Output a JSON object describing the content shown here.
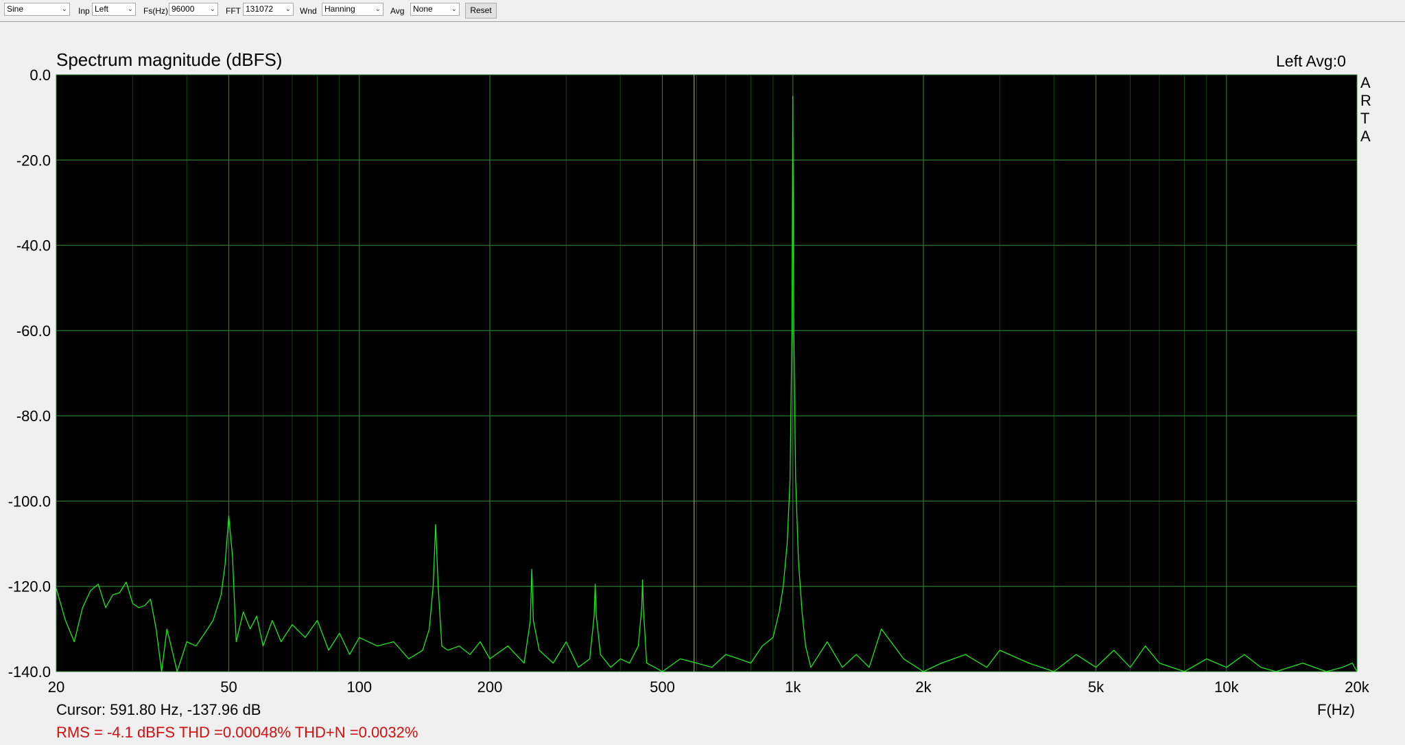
{
  "toolbar": {
    "generator": "Sine",
    "inp_label": "Inp",
    "inp_value": "Left",
    "fs_label": "Fs(Hz)",
    "fs_value": "96000",
    "fft_label": "FFT",
    "fft_value": "131072",
    "wnd_label": "Wnd",
    "wnd_value": "Hanning",
    "avg_label": "Avg",
    "avg_value": "None",
    "reset_label": "Reset",
    "chevron": "⌄"
  },
  "header": {
    "title": "Spectrum magnitude (dBFS)",
    "channel_info": "Left  Avg:0",
    "brand_letters": [
      "A",
      "R",
      "T",
      "A"
    ]
  },
  "footer": {
    "cursor_readout": "Cursor: 591.80 Hz, -137.96 dB",
    "measurement_readout": "RMS =   -4.1 dBFS THD =0.00048% THD+N =0.0032%",
    "x_axis_label": "F(Hz)"
  },
  "colors": {
    "plot_background": "#000000",
    "trace": "#1ee81e",
    "grid": "#1a5a1a",
    "cursor_line": "#b0a020",
    "readout_red": "#d01010"
  },
  "chart_data": {
    "type": "line",
    "title": "Spectrum magnitude (dBFS)",
    "xlabel": "F(Hz)",
    "ylabel": "",
    "x_scale": "log",
    "xlim": [
      20,
      20000
    ],
    "ylim": [
      -140,
      0
    ],
    "grid": true,
    "y_ticks": [
      0,
      -20,
      -40,
      -60,
      -80,
      -100,
      -120,
      -140
    ],
    "y_tick_labels": [
      "0.0",
      "-20.0",
      "-40.0",
      "-60.0",
      "-80.0",
      "-100.0",
      "-120.0",
      "-140.0"
    ],
    "x_ticks": [
      20,
      50,
      100,
      200,
      500,
      1000,
      2000,
      5000,
      10000,
      20000
    ],
    "x_tick_labels": [
      "20",
      "50",
      "100",
      "200",
      "500",
      "1k",
      "2k",
      "5k",
      "10k",
      "20k"
    ],
    "cursor_frequency": 591.8,
    "series": [
      {
        "x": [
          20,
          21,
          22,
          23,
          24,
          25,
          26,
          27,
          28,
          29,
          30,
          31,
          32,
          33,
          34,
          35,
          36,
          37,
          38,
          40,
          42,
          44,
          46,
          48,
          49,
          50,
          51,
          52,
          54,
          56,
          58,
          60,
          63,
          66,
          70,
          75,
          80,
          85,
          90,
          95,
          100,
          110,
          120,
          130,
          140,
          145,
          148,
          150,
          152,
          155,
          160,
          170,
          180,
          190,
          200,
          220,
          240,
          248,
          250,
          252,
          260,
          280,
          300,
          320,
          340,
          348,
          350,
          352,
          360,
          380,
          400,
          420,
          440,
          448,
          450,
          452,
          460,
          480,
          500,
          550,
          600,
          650,
          700,
          750,
          800,
          850,
          900,
          930,
          950,
          970,
          985,
          995,
          1000,
          1005,
          1015,
          1030,
          1050,
          1070,
          1100,
          1200,
          1300,
          1400,
          1500,
          1600,
          1800,
          2000,
          2200,
          2500,
          2800,
          3000,
          3500,
          4000,
          4500,
          5000,
          5500,
          6000,
          6500,
          7000,
          8000,
          9000,
          10000,
          11000,
          12000,
          13000,
          15000,
          17000,
          18500,
          19500,
          20000
        ],
        "y": [
          -120.5,
          -128,
          -133,
          -125,
          -121,
          -119.5,
          -125,
          -122,
          -121.5,
          -119,
          -124,
          -125,
          -124.5,
          -123,
          -130,
          -140,
          -130,
          -135,
          -140,
          -133,
          -134,
          -131,
          -128,
          -122,
          -115,
          -103.5,
          -113,
          -133,
          -126,
          -130,
          -127,
          -134,
          -128,
          -133,
          -129,
          -132,
          -128,
          -135,
          -131,
          -136,
          -132,
          -134,
          -133,
          -137,
          -135,
          -130,
          -120,
          -105.5,
          -120,
          -134,
          -135,
          -134,
          -136,
          -133,
          -137,
          -134,
          -138,
          -128,
          -116,
          -128,
          -135,
          -138,
          -133,
          -139,
          -137,
          -127,
          -119.5,
          -127,
          -136,
          -139,
          -137,
          -138,
          -134,
          -125,
          -118.5,
          -125,
          -138,
          -139,
          -140,
          -137,
          -138,
          -139,
          -136,
          -137,
          -138,
          -134,
          -132,
          -126,
          -120,
          -110,
          -95,
          -60,
          -5,
          -60,
          -95,
          -114,
          -126,
          -134,
          -139,
          -133,
          -139,
          -136,
          -139,
          -130,
          -137,
          -140,
          -138,
          -136,
          -139,
          -135,
          -138,
          -140,
          -136,
          -139,
          -135,
          -139,
          -134,
          -138,
          -140,
          -137,
          -139,
          -136,
          -139,
          -140,
          -138,
          -140,
          -139,
          -138,
          -140
        ]
      }
    ]
  }
}
